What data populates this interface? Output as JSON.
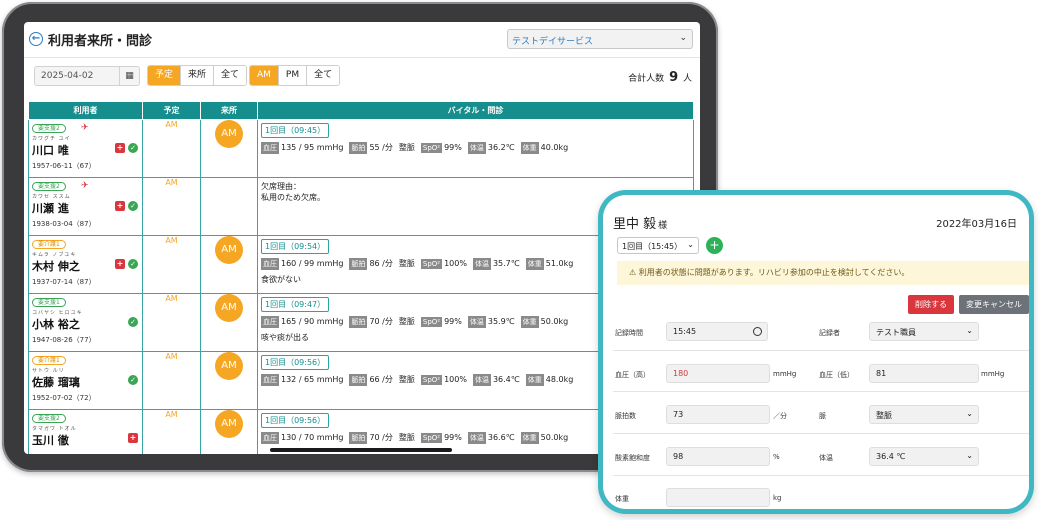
{
  "tablet": {
    "header": {
      "title": "利用者来所・問診",
      "service": "テストデイサービス"
    },
    "filters": {
      "date": "2025-04-02",
      "status_options": [
        "予定",
        "来所",
        "全て"
      ],
      "status_selected": "予定",
      "period_options": [
        "AM",
        "PM",
        "全て"
      ],
      "period_selected": "AM",
      "total_label": "合計人数",
      "total_count": "9",
      "total_unit": "人"
    },
    "table": {
      "columns": [
        "利用者",
        "予定",
        "来所",
        "バイタル・問診"
      ],
      "rows": [
        {
          "care": "要支援2",
          "care_color": "green",
          "kana": "カワグチ ユイ",
          "name": "川口 唯",
          "birth": "1957-06-11（67）",
          "plan": "AM",
          "visit": "AM",
          "round": "1回目（09:45）",
          "vitals": [
            [
              "血圧",
              "135 / 95 mmHg"
            ],
            [
              "脈拍",
              "55 /分"
            ],
            [
              "整脈",
              ""
            ],
            [
              "SpO²",
              "99%"
            ],
            [
              "体温",
              "36.2℃"
            ],
            [
              "体重",
              "40.0kg"
            ]
          ],
          "note": ""
        },
        {
          "care": "要支援2",
          "care_color": "green",
          "kana": "カワセ ススム",
          "name": "川瀬 進",
          "birth": "1938-03-04（87）",
          "plan": "AM",
          "visit": "",
          "absent_label": "欠席理由：",
          "absent_reason": "私用のため欠席。"
        },
        {
          "care": "要介護1",
          "care_color": "orange",
          "kana": "キムラ ノブユキ",
          "name": "木村 伸之",
          "birth": "1937-07-14（87）",
          "plan": "AM",
          "visit": "AM",
          "round": "1回目（09:54）",
          "vitals": [
            [
              "血圧",
              "160 / 99 mmHg"
            ],
            [
              "脈拍",
              "86 /分"
            ],
            [
              "整脈",
              ""
            ],
            [
              "SpO²",
              "100%"
            ],
            [
              "体温",
              "35.7℃"
            ],
            [
              "体重",
              "51.0kg"
            ]
          ],
          "note": "食欲がない"
        },
        {
          "care": "要支援1",
          "care_color": "green",
          "kana": "コバヤシ ヒロユキ",
          "name": "小林 裕之",
          "birth": "1947-08-26（77）",
          "plan": "AM",
          "visit": "AM",
          "round": "1回目（09:47）",
          "vitals": [
            [
              "血圧",
              "165 / 90 mmHg"
            ],
            [
              "脈拍",
              "70 /分"
            ],
            [
              "整脈",
              ""
            ],
            [
              "SpO²",
              "99%"
            ],
            [
              "体温",
              "35.9℃"
            ],
            [
              "体重",
              "50.0kg"
            ]
          ],
          "note": "咳や痰が出る"
        },
        {
          "care": "要介護1",
          "care_color": "orange",
          "kana": "サトウ ルリ",
          "name": "佐藤 瑠璃",
          "birth": "1952-07-02（72）",
          "plan": "AM",
          "visit": "AM",
          "round": "1回目（09:56）",
          "vitals": [
            [
              "血圧",
              "132 / 65 mmHg"
            ],
            [
              "脈拍",
              "66 /分"
            ],
            [
              "整脈",
              ""
            ],
            [
              "SpO²",
              "100%"
            ],
            [
              "体温",
              "36.4℃"
            ],
            [
              "体重",
              "48.0kg"
            ]
          ],
          "note": ""
        },
        {
          "care": "要支援2",
          "care_color": "green",
          "kana": "タマガワ トオル",
          "name": "玉川 徹",
          "birth": "",
          "plan": "AM",
          "visit": "AM",
          "round": "1回目（09:56）",
          "vitals": [
            [
              "血圧",
              "130 / 70 mmHg"
            ],
            [
              "脈拍",
              "70 /分"
            ],
            [
              "整脈",
              ""
            ],
            [
              "SpO²",
              "99%"
            ],
            [
              "体温",
              "36.6℃"
            ],
            [
              "体重",
              "50.0kg"
            ]
          ],
          "note": ""
        }
      ]
    }
  },
  "detail": {
    "name": "里中 毅",
    "honorific": "様",
    "date": "2022年03月16日",
    "round": "1回目（15:45）",
    "add_label": "+",
    "warning": "⚠ 利用者の状態に問題があります。リハビリ参加の中止を検討してください。",
    "delete_label": "削除する",
    "cancel_label": "変更キャンセル",
    "fields": {
      "record_time_label": "記録時間",
      "record_time": "15:45",
      "recorder_label": "記録者",
      "recorder": "テスト職員",
      "bp_high_label": "血圧（高）",
      "bp_high": "180",
      "bp_high_unit": "mmHg",
      "bp_low_label": "血圧（低）",
      "bp_low": "81",
      "bp_low_unit": "mmHg",
      "pulse_label": "脈拍数",
      "pulse": "73",
      "pulse_unit": "／分",
      "rhythm_label": "脈",
      "rhythm": "整脈",
      "spo2_label": "酸素飽和度",
      "spo2": "98",
      "spo2_unit": "%",
      "temp_label": "体温",
      "temp": "36.4 ℃",
      "weight_label": "体重",
      "weight": "",
      "weight_unit": "kg"
    }
  }
}
